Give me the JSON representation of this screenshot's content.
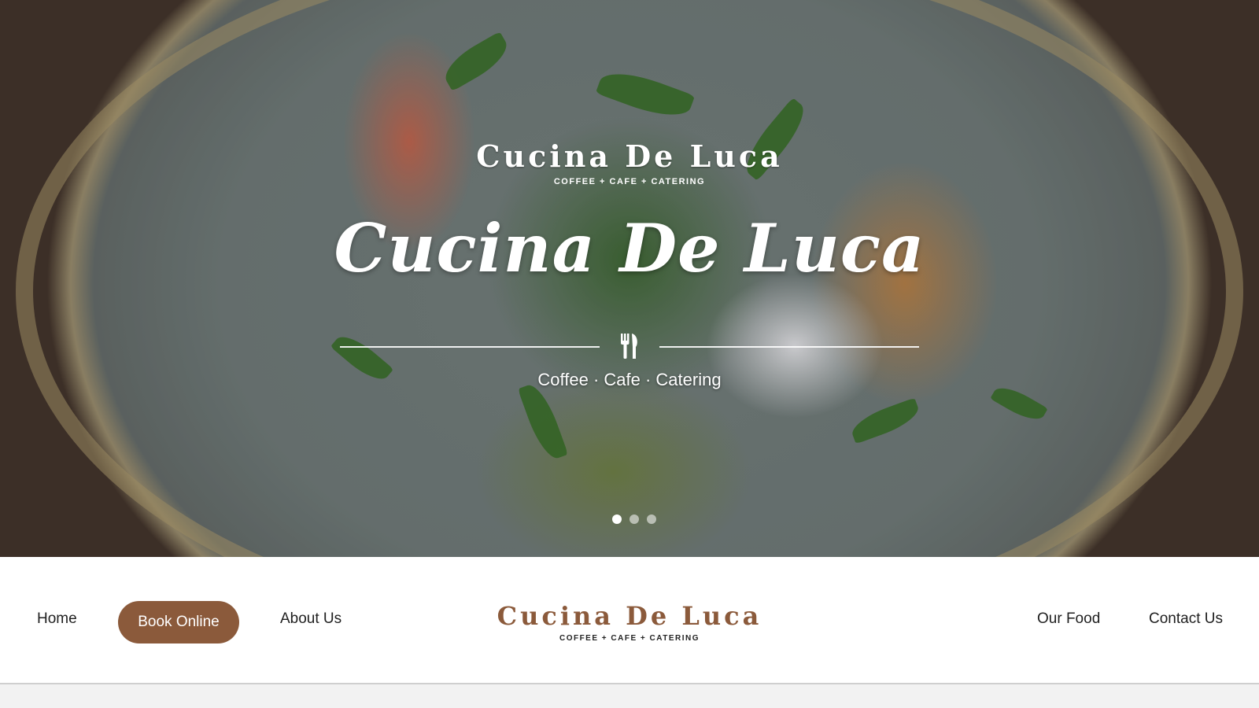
{
  "hero": {
    "logo_brand": "Cucina De Luca",
    "logo_tagline": "COFFEE + CAFE + CATERING",
    "title": "Cucina De Luca",
    "subtitle": "Coffee · Cafe · Catering",
    "icon": "cutlery-icon",
    "slides": {
      "count": 3,
      "active": 1
    }
  },
  "nav": {
    "home": "Home",
    "book_online": "Book Online",
    "about": "About Us",
    "logo_brand": "Cucina De Luca",
    "logo_tagline": "COFFEE + CAFE + CATERING",
    "our_food": "Our Food",
    "contact": "Contact Us"
  },
  "colors": {
    "accent_brown": "#8b5a3b",
    "nav_background": "#ffffff",
    "text_dark": "#1f1f1f"
  }
}
